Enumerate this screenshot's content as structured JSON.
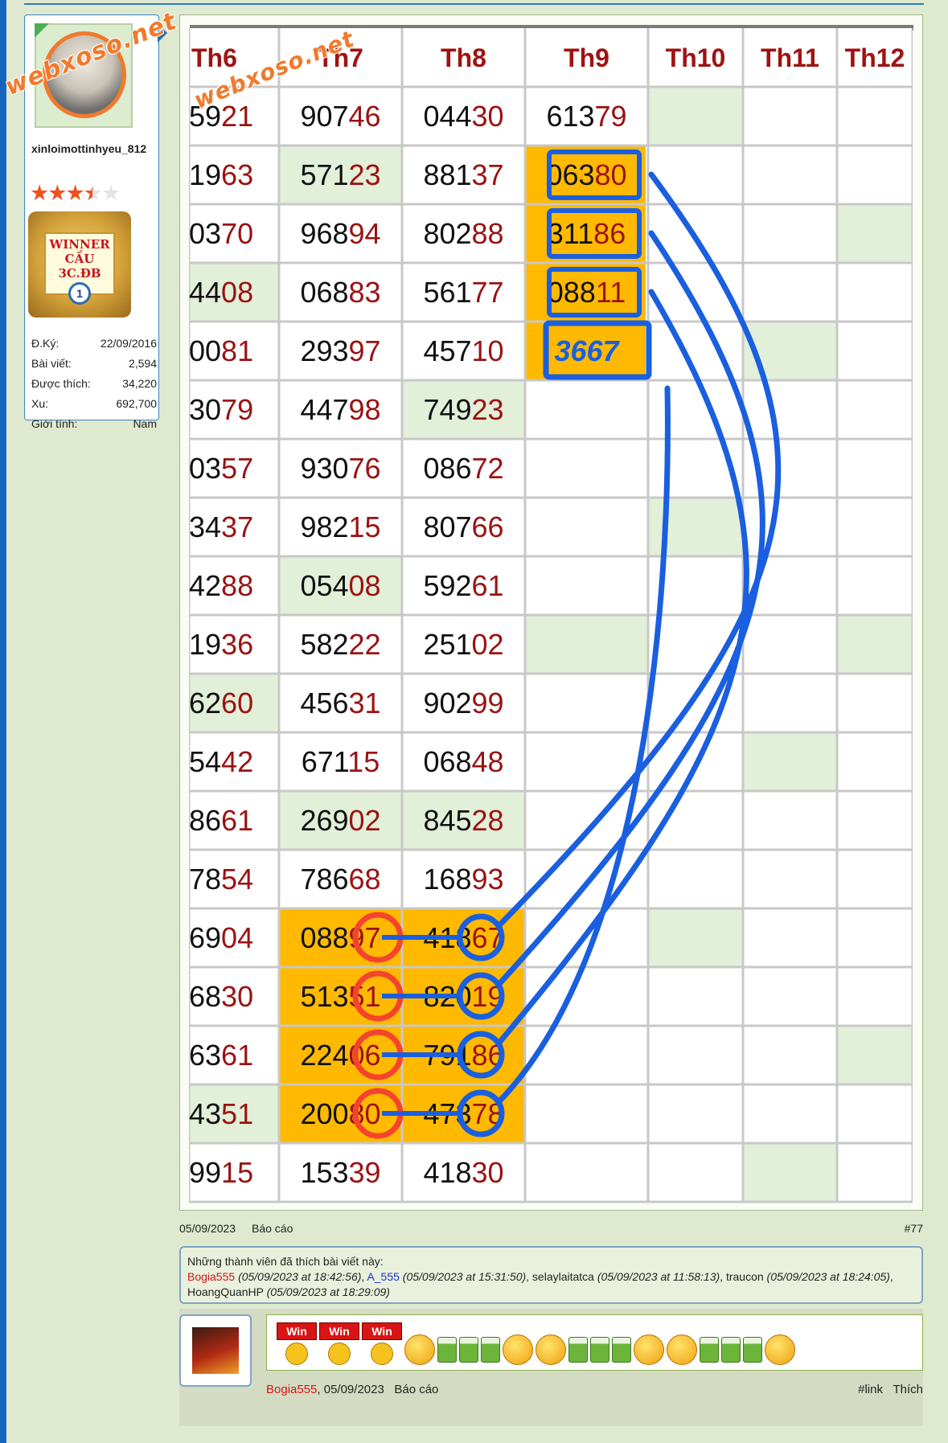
{
  "watermark": "webxoso.net",
  "user": {
    "username": "xinloimottinhyeu_812",
    "rating_stars": 3.5,
    "rating_max": 5,
    "badge_line1": "WINNER",
    "badge_line2": "CẦU 3C.ĐB",
    "badge_number": "1",
    "stats": [
      {
        "label": "Đ.Ký:",
        "value": "22/09/2016"
      },
      {
        "label": "Bài viết:",
        "value": "2,594"
      },
      {
        "label": "Được thích:",
        "value": "34,220"
      },
      {
        "label": "Xu:",
        "value": "692,700"
      },
      {
        "label": "Giới tính:",
        "value": "Nam"
      }
    ]
  },
  "table": {
    "headers": [
      "Th6",
      "Th7",
      "Th8",
      "Th9",
      "Th10",
      "Th11",
      "Th12"
    ],
    "columns": [
      [
        "5921",
        "1963",
        "0370",
        "4408",
        "0081",
        "3079",
        "0357",
        "3437",
        "4288",
        "1936",
        "6260",
        "5442",
        "8661",
        "7854",
        "6904",
        "6830",
        "6361",
        "4351",
        "9915"
      ],
      [
        "90746",
        "57123",
        "96894",
        "06883",
        "29397",
        "44798",
        "93076",
        "98215",
        "05408",
        "58222",
        "45631",
        "67115",
        "26902",
        "78668",
        "08897",
        "51351",
        "22406",
        "20080",
        "15339"
      ],
      [
        "04430",
        "88137",
        "80288",
        "56177",
        "45710",
        "74923",
        "08672",
        "80766",
        "59261",
        "25102",
        "90299",
        "06848",
        "84528",
        "16893",
        "41867",
        "82019",
        "79186",
        "47378",
        "41830"
      ],
      [
        "61379",
        "06380",
        "31186",
        "08811",
        "3667",
        "",
        "",
        "",
        "",
        "",
        "",
        "",
        "",
        "",
        "",
        "",
        "",
        "",
        ""
      ]
    ],
    "highlight_color": "#ffb900",
    "annotation_red": "#f4442e",
    "annotation_blue": "#1a5fe0"
  },
  "post": {
    "date": "05/09/2023",
    "report": "Báo cáo",
    "number": "#77"
  },
  "likes": {
    "intro": "Những thành viên đã thích bài viết này:",
    "entries": [
      {
        "name": "Bogia555",
        "time": "(05/09/2023 at 18:42:56)",
        "color": "red"
      },
      {
        "name": "A_555",
        "time": "(05/09/2023 at 15:31:50)",
        "color": "blue"
      },
      {
        "name": "selaylaitatca",
        "time": "(05/09/2023 at 11:58:13)",
        "color": "black"
      },
      {
        "name": "traucon",
        "time": "(05/09/2023 at 18:24:05)",
        "color": "black"
      },
      {
        "name": "HoangQuanHP",
        "time": "(05/09/2023 at 18:29:09)",
        "color": "black"
      }
    ]
  },
  "reply": {
    "win_label": "Win",
    "author": "Bogia555",
    "date": ", 05/09/2023",
    "report": "Báo cáo",
    "link": "#link",
    "like": "Thích"
  }
}
